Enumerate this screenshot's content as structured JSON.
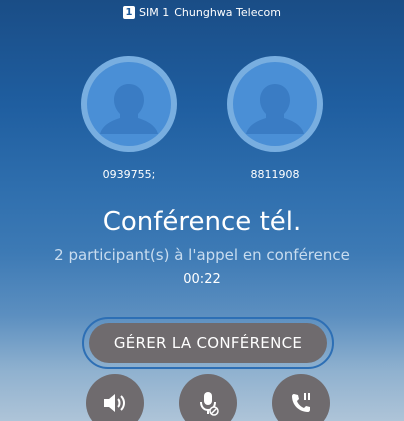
{
  "status_bar": {
    "sim_badge": "1",
    "sim_label": "SIM 1",
    "carrier": "Chunghwa Telecom"
  },
  "participants": [
    {
      "number": "0939755;"
    },
    {
      "number": "8811908"
    }
  ],
  "call": {
    "title": "Conférence tél.",
    "subtitle": "2 participant(s) à l'appel en conférence",
    "duration": "00:22"
  },
  "actions": {
    "manage_conference_label": "GÉRER LA CONFÉRENCE"
  },
  "controls": [
    {
      "icon": "speaker-icon"
    },
    {
      "icon": "mute-mic-icon"
    },
    {
      "icon": "hold-call-icon"
    }
  ]
}
